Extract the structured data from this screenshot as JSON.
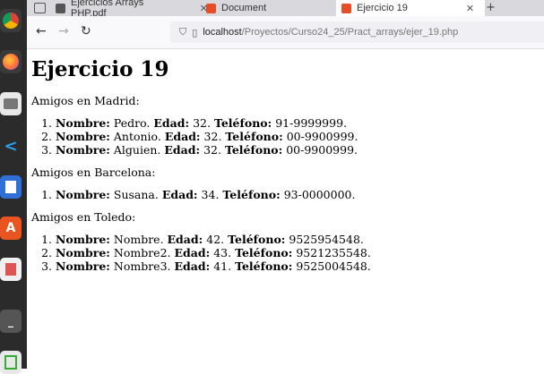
{
  "browser": {
    "tabs": [
      {
        "label": "Ejercicios Arrays PHP.pdf",
        "active": false
      },
      {
        "label": "Document",
        "active": false
      },
      {
        "label": "Ejercicio 19",
        "active": true
      }
    ],
    "new_tab": "+",
    "url_host": "localhost",
    "url_path": "/Proyectos/Curso24_25/Pract_arrays/ejer_19.php"
  },
  "page": {
    "title": "Ejercicio 19",
    "labels": {
      "name": "Nombre:",
      "age": "Edad:",
      "phone": "Teléfono:"
    },
    "groups": [
      {
        "heading": "Amigos en Madrid:",
        "friends": [
          {
            "name": "Pedro.",
            "age": "32.",
            "phone": "91-9999999."
          },
          {
            "name": "Antonio.",
            "age": "32.",
            "phone": "00-9900999."
          },
          {
            "name": "Alguien.",
            "age": "32.",
            "phone": "00-9900999."
          }
        ]
      },
      {
        "heading": "Amigos en Barcelona:",
        "friends": [
          {
            "name": "Susana.",
            "age": "34.",
            "phone": "93-0000000."
          }
        ]
      },
      {
        "heading": "Amigos en Toledo:",
        "friends": [
          {
            "name": "Nombre.",
            "age": "42.",
            "phone": "9525954548."
          },
          {
            "name": "Nombre2.",
            "age": "43.",
            "phone": "9521235548."
          },
          {
            "name": "Nombre3.",
            "age": "41.",
            "phone": "9525004548."
          }
        ]
      }
    ]
  }
}
